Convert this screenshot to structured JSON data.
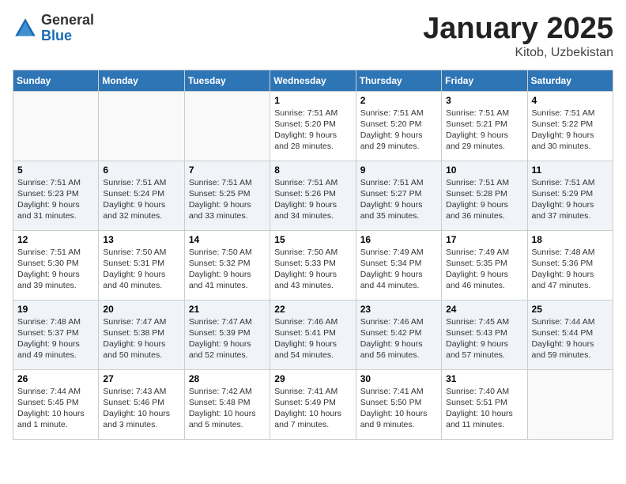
{
  "header": {
    "logo": {
      "general": "General",
      "blue": "Blue"
    },
    "title": "January 2025",
    "location": "Kitob, Uzbekistan"
  },
  "weekdays": [
    "Sunday",
    "Monday",
    "Tuesday",
    "Wednesday",
    "Thursday",
    "Friday",
    "Saturday"
  ],
  "weeks": [
    [
      {
        "day": "",
        "info": ""
      },
      {
        "day": "",
        "info": ""
      },
      {
        "day": "",
        "info": ""
      },
      {
        "day": "1",
        "info": "Sunrise: 7:51 AM\nSunset: 5:20 PM\nDaylight: 9 hours\nand 28 minutes."
      },
      {
        "day": "2",
        "info": "Sunrise: 7:51 AM\nSunset: 5:20 PM\nDaylight: 9 hours\nand 29 minutes."
      },
      {
        "day": "3",
        "info": "Sunrise: 7:51 AM\nSunset: 5:21 PM\nDaylight: 9 hours\nand 29 minutes."
      },
      {
        "day": "4",
        "info": "Sunrise: 7:51 AM\nSunset: 5:22 PM\nDaylight: 9 hours\nand 30 minutes."
      }
    ],
    [
      {
        "day": "5",
        "info": "Sunrise: 7:51 AM\nSunset: 5:23 PM\nDaylight: 9 hours\nand 31 minutes."
      },
      {
        "day": "6",
        "info": "Sunrise: 7:51 AM\nSunset: 5:24 PM\nDaylight: 9 hours\nand 32 minutes."
      },
      {
        "day": "7",
        "info": "Sunrise: 7:51 AM\nSunset: 5:25 PM\nDaylight: 9 hours\nand 33 minutes."
      },
      {
        "day": "8",
        "info": "Sunrise: 7:51 AM\nSunset: 5:26 PM\nDaylight: 9 hours\nand 34 minutes."
      },
      {
        "day": "9",
        "info": "Sunrise: 7:51 AM\nSunset: 5:27 PM\nDaylight: 9 hours\nand 35 minutes."
      },
      {
        "day": "10",
        "info": "Sunrise: 7:51 AM\nSunset: 5:28 PM\nDaylight: 9 hours\nand 36 minutes."
      },
      {
        "day": "11",
        "info": "Sunrise: 7:51 AM\nSunset: 5:29 PM\nDaylight: 9 hours\nand 37 minutes."
      }
    ],
    [
      {
        "day": "12",
        "info": "Sunrise: 7:51 AM\nSunset: 5:30 PM\nDaylight: 9 hours\nand 39 minutes."
      },
      {
        "day": "13",
        "info": "Sunrise: 7:50 AM\nSunset: 5:31 PM\nDaylight: 9 hours\nand 40 minutes."
      },
      {
        "day": "14",
        "info": "Sunrise: 7:50 AM\nSunset: 5:32 PM\nDaylight: 9 hours\nand 41 minutes."
      },
      {
        "day": "15",
        "info": "Sunrise: 7:50 AM\nSunset: 5:33 PM\nDaylight: 9 hours\nand 43 minutes."
      },
      {
        "day": "16",
        "info": "Sunrise: 7:49 AM\nSunset: 5:34 PM\nDaylight: 9 hours\nand 44 minutes."
      },
      {
        "day": "17",
        "info": "Sunrise: 7:49 AM\nSunset: 5:35 PM\nDaylight: 9 hours\nand 46 minutes."
      },
      {
        "day": "18",
        "info": "Sunrise: 7:48 AM\nSunset: 5:36 PM\nDaylight: 9 hours\nand 47 minutes."
      }
    ],
    [
      {
        "day": "19",
        "info": "Sunrise: 7:48 AM\nSunset: 5:37 PM\nDaylight: 9 hours\nand 49 minutes."
      },
      {
        "day": "20",
        "info": "Sunrise: 7:47 AM\nSunset: 5:38 PM\nDaylight: 9 hours\nand 50 minutes."
      },
      {
        "day": "21",
        "info": "Sunrise: 7:47 AM\nSunset: 5:39 PM\nDaylight: 9 hours\nand 52 minutes."
      },
      {
        "day": "22",
        "info": "Sunrise: 7:46 AM\nSunset: 5:41 PM\nDaylight: 9 hours\nand 54 minutes."
      },
      {
        "day": "23",
        "info": "Sunrise: 7:46 AM\nSunset: 5:42 PM\nDaylight: 9 hours\nand 56 minutes."
      },
      {
        "day": "24",
        "info": "Sunrise: 7:45 AM\nSunset: 5:43 PM\nDaylight: 9 hours\nand 57 minutes."
      },
      {
        "day": "25",
        "info": "Sunrise: 7:44 AM\nSunset: 5:44 PM\nDaylight: 9 hours\nand 59 minutes."
      }
    ],
    [
      {
        "day": "26",
        "info": "Sunrise: 7:44 AM\nSunset: 5:45 PM\nDaylight: 10 hours\nand 1 minute."
      },
      {
        "day": "27",
        "info": "Sunrise: 7:43 AM\nSunset: 5:46 PM\nDaylight: 10 hours\nand 3 minutes."
      },
      {
        "day": "28",
        "info": "Sunrise: 7:42 AM\nSunset: 5:48 PM\nDaylight: 10 hours\nand 5 minutes."
      },
      {
        "day": "29",
        "info": "Sunrise: 7:41 AM\nSunset: 5:49 PM\nDaylight: 10 hours\nand 7 minutes."
      },
      {
        "day": "30",
        "info": "Sunrise: 7:41 AM\nSunset: 5:50 PM\nDaylight: 10 hours\nand 9 minutes."
      },
      {
        "day": "31",
        "info": "Sunrise: 7:40 AM\nSunset: 5:51 PM\nDaylight: 10 hours\nand 11 minutes."
      },
      {
        "day": "",
        "info": ""
      }
    ]
  ]
}
